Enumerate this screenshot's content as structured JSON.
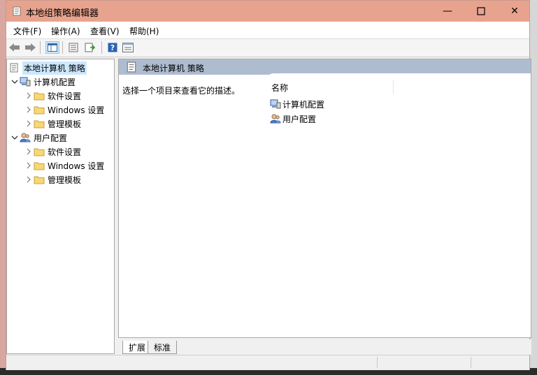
{
  "window": {
    "title": "本地组策略编辑器"
  },
  "title_buttons": {
    "minimize": "—",
    "close": "✕"
  },
  "menu": [
    {
      "label": "文件(F)"
    },
    {
      "label": "操作(A)"
    },
    {
      "label": "查看(V)"
    },
    {
      "label": "帮助(H)"
    }
  ],
  "tree": {
    "root": {
      "label": "本地计算机 策略"
    },
    "computer": {
      "label": "计算机配置",
      "children": [
        {
          "label": "软件设置"
        },
        {
          "label": "Windows 设置"
        },
        {
          "label": "管理模板"
        }
      ]
    },
    "user": {
      "label": "用户配置",
      "children": [
        {
          "label": "软件设置"
        },
        {
          "label": "Windows 设置"
        },
        {
          "label": "管理模板"
        }
      ]
    }
  },
  "right_pane": {
    "header": "本地计算机 策略",
    "description": "选择一个项目来查看它的描述。",
    "column_name": "名称",
    "items": [
      {
        "label": "计算机配置"
      },
      {
        "label": "用户配置"
      }
    ]
  },
  "tabs": [
    {
      "label": "扩展"
    },
    {
      "label": "标准"
    }
  ],
  "colors": {
    "titlebar": "#e8a38e",
    "header": "#aebcd0",
    "selection": "#cce8ff"
  }
}
